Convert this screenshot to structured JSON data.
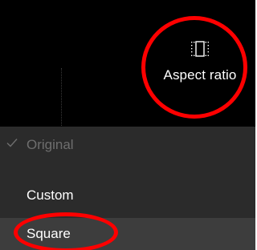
{
  "toolbar": {
    "aspect_ratio_label": "Aspect ratio",
    "aspect_ratio_icon": "aspect-ratio-icon"
  },
  "menu": {
    "items": [
      {
        "label": "Original",
        "state": "disabled",
        "checked": true
      },
      {
        "label": "Custom",
        "state": "enabled",
        "checked": false
      },
      {
        "label": "Square",
        "state": "highlighted",
        "checked": false
      }
    ]
  },
  "colors": {
    "toolbar_background": "#000000",
    "menu_background": "#2b2b2b",
    "menu_highlight": "#3d3d3d",
    "annotation_ring": "#ff0000",
    "disabled_text": "#6e6e6e",
    "text": "#ffffff"
  }
}
